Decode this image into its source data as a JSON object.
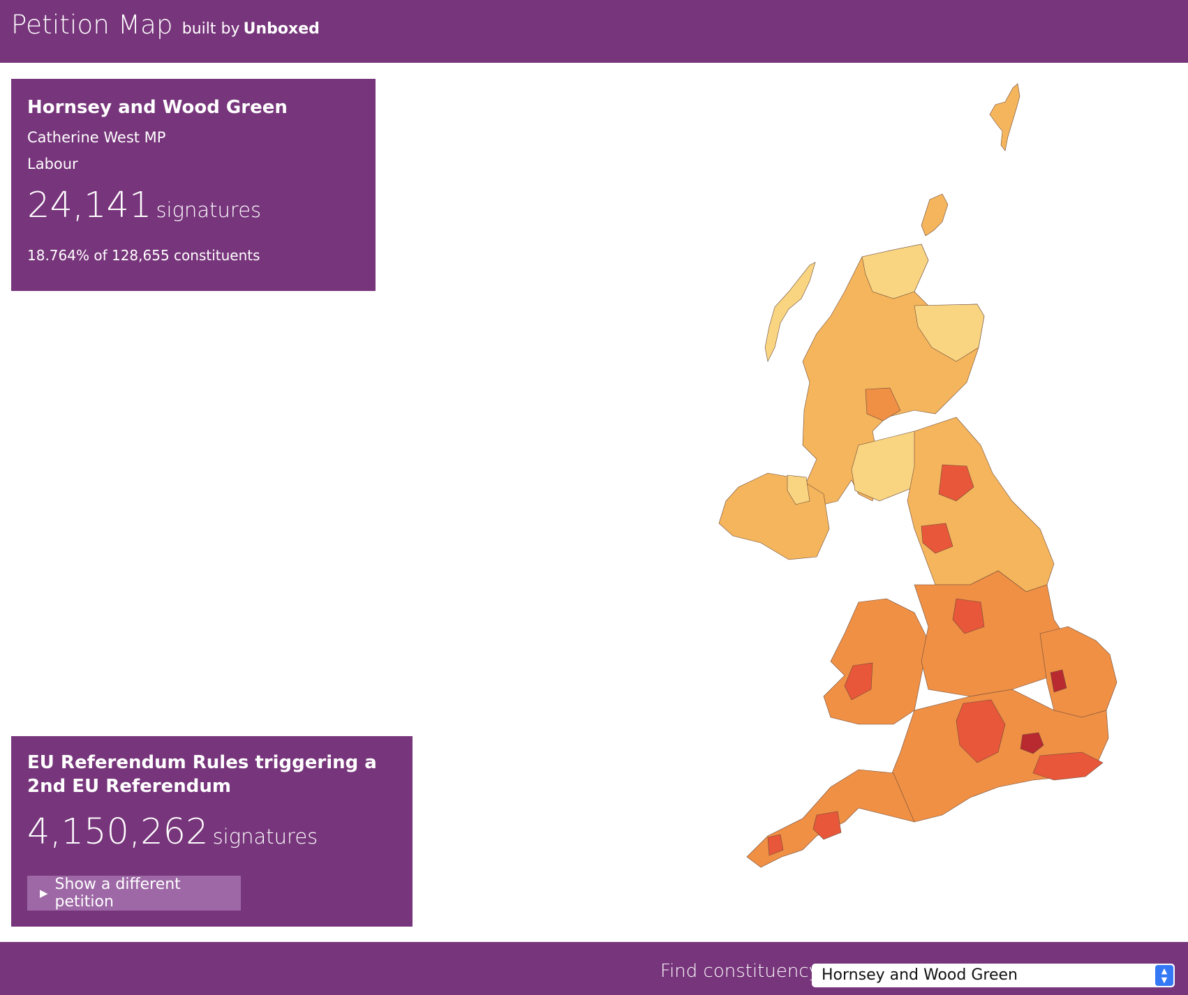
{
  "header": {
    "app_name": "Petition Map",
    "built_by": "built by",
    "company": "Unboxed"
  },
  "constituency": {
    "name": "Hornsey and Wood Green",
    "mp": "Catherine West MP",
    "party": "Labour",
    "signatures": "24,141",
    "signatures_unit": "signatures",
    "share": "18.764% of 128,655 constituents"
  },
  "petition": {
    "title": "EU Referendum Rules triggering a 2nd EU Referendum",
    "signatures": "4,150,262",
    "signatures_unit": "signatures",
    "button_label": "Show a different petition",
    "button_icon": "play-triangle-icon"
  },
  "footer": {
    "find_label": "Find constituency",
    "selected_constituency": "Hornsey and Wood Green",
    "select_icon": "chevron-up-down-icon"
  },
  "map": {
    "colors": {
      "lightest": "#f9d582",
      "light": "#f5b55c",
      "medium": "#f09045",
      "high": "#e9573a",
      "highest": "#b92a30",
      "border": "#6b4a3a"
    }
  }
}
